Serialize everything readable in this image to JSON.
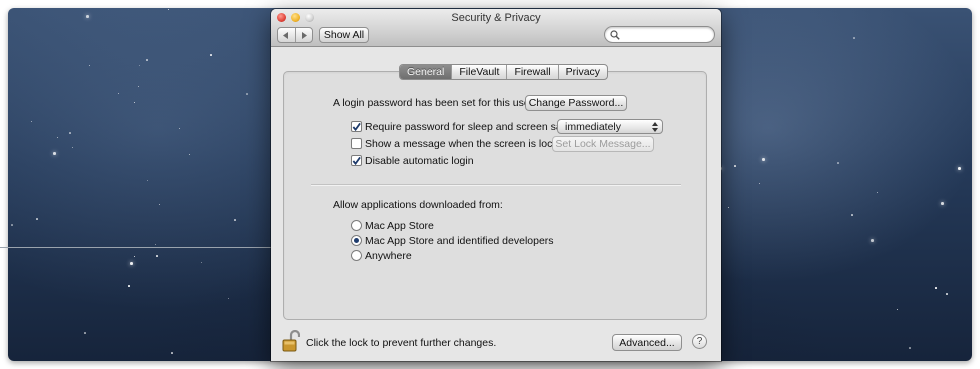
{
  "window": {
    "title": "Security & Privacy",
    "nav": {
      "back_icon": "chevron-left-icon",
      "forward_icon": "chevron-right-icon"
    },
    "show_all_label": "Show All",
    "search": {
      "placeholder": "",
      "value": ""
    }
  },
  "tabs": [
    {
      "label": "General",
      "selected": true
    },
    {
      "label": "FileVault",
      "selected": false
    },
    {
      "label": "Firewall",
      "selected": false
    },
    {
      "label": "Privacy",
      "selected": false
    }
  ],
  "general": {
    "login_password_text": "A login password has been set for this user",
    "change_password_label": "Change Password...",
    "require_password": {
      "label": "Require password for sleep and screen saver",
      "checked": true
    },
    "require_password_delay": {
      "value": "immediately"
    },
    "show_message": {
      "label": "Show a message when the screen is locked",
      "checked": false
    },
    "set_lock_message_label": "Set Lock Message...",
    "disable_auto_login": {
      "label": "Disable automatic login",
      "checked": true
    }
  },
  "downloads": {
    "heading": "Allow applications downloaded from:",
    "options": [
      {
        "label": "Mac App Store",
        "selected": false
      },
      {
        "label": "Mac App Store and identified developers",
        "selected": true
      },
      {
        "label": "Anywhere",
        "selected": false
      }
    ]
  },
  "footer": {
    "lock_text": "Click the lock to prevent further changes.",
    "advanced_label": "Advanced...",
    "help_label": "?"
  },
  "colors": {
    "selected_tab": "#7f7f7f",
    "radio_dot": "#1e3c6e",
    "checkmark": "#1d3a6b"
  }
}
